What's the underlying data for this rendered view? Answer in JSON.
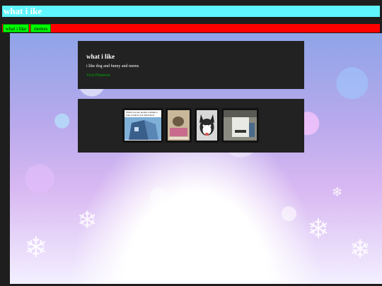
{
  "page": {
    "title": "what i ike"
  },
  "nav": {
    "tabs": [
      {
        "label": "what i like"
      },
      {
        "label": "memes"
      }
    ]
  },
  "about": {
    "heading": "what i like",
    "text": "i like dog and funny and mems",
    "link": "Visit Pinterest"
  },
  "gallery": {
    "items": [
      {
        "caption": "When you see people coming to your work for job interviews"
      },
      {
        "caption": ""
      },
      {
        "caption": ""
      },
      {
        "caption": ""
      }
    ]
  },
  "colors": {
    "title_bar": "#5ff5ff",
    "nav_bar": "#ff0000",
    "nav_tab": "#00ff00",
    "card": "#222222",
    "link": "#00aa00"
  }
}
